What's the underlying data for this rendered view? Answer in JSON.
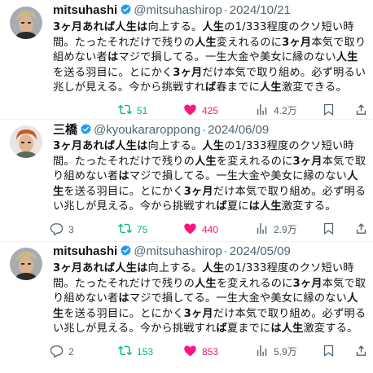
{
  "colors": {
    "retweet": "#00ba7c",
    "like": "#f91880",
    "verified": "#1d9bf0",
    "muted": "#536471"
  },
  "tweets": [
    {
      "name": "mitsuhashi",
      "verified": true,
      "handle": "@mitsuhashirop",
      "date": "2024/10/21",
      "segments": [
        {
          "t": "3ヶ月あれば人生は",
          "b": true
        },
        {
          "t": "向上する。",
          "b": false
        },
        {
          "t": "人生",
          "b": true
        },
        {
          "t": "の1/333程度のクソ短い時間。たったそれだけで残りの",
          "b": false
        },
        {
          "t": "人生",
          "b": true
        },
        {
          "t": "変えれるのに",
          "b": false
        },
        {
          "t": "3ヶ月",
          "b": true
        },
        {
          "t": "本気で取り組めない者",
          "b": false
        },
        {
          "t": "は",
          "b": true
        },
        {
          "t": "マジで損してる。一生大金や美女に縁のない",
          "b": false
        },
        {
          "t": "人生",
          "b": true
        },
        {
          "t": "を送る羽目に。とにかく",
          "b": false
        },
        {
          "t": "3ヶ月",
          "b": true
        },
        {
          "t": "だけ本気で取り組め。必ず明るい兆しが見える。今から挑戦すれ",
          "b": false
        },
        {
          "t": "ば",
          "b": true
        },
        {
          "t": "春までに",
          "b": false
        },
        {
          "t": "人生",
          "b": true
        },
        {
          "t": "激変できる。",
          "b": false
        }
      ],
      "reply_count": "",
      "retweet_count": "51",
      "like_count": "425",
      "view_count": "4.2万"
    },
    {
      "name": "三橋",
      "verified": true,
      "handle": "@kyoukararoppong",
      "date": "2024/06/09",
      "segments": [
        {
          "t": "3ヶ月あれば人生は",
          "b": true
        },
        {
          "t": "向上する。",
          "b": false
        },
        {
          "t": "人生",
          "b": true
        },
        {
          "t": "の1/333程度のクソ短い時間。たったそれだけで残りの",
          "b": false
        },
        {
          "t": "人生",
          "b": true
        },
        {
          "t": "を変えれるのに",
          "b": false
        },
        {
          "t": "3ヶ月",
          "b": true
        },
        {
          "t": "本気で取り組めない者",
          "b": false
        },
        {
          "t": "は",
          "b": true
        },
        {
          "t": "マジで損してる。一生大金や美女に縁のない",
          "b": false
        },
        {
          "t": "人生",
          "b": true
        },
        {
          "t": "を送る羽目に。とにかく",
          "b": false
        },
        {
          "t": "3ヶ月",
          "b": true
        },
        {
          "t": "だけ本気で取り組め。必ず明るい兆しが見える。今から挑戦すれ",
          "b": false
        },
        {
          "t": "ば",
          "b": true
        },
        {
          "t": "夏に",
          "b": false
        },
        {
          "t": "は人生",
          "b": true
        },
        {
          "t": "激変する。",
          "b": false
        }
      ],
      "reply_count": "3",
      "retweet_count": "75",
      "like_count": "440",
      "view_count": "2.9万"
    },
    {
      "name": "mitsuhashi",
      "verified": true,
      "handle": "@mitsuhashirop",
      "date": "2024/05/09",
      "segments": [
        {
          "t": "3ヶ月あれば人生は",
          "b": true
        },
        {
          "t": "向上する。",
          "b": false
        },
        {
          "t": "人生",
          "b": true
        },
        {
          "t": "の1/333程度のクソ短い時間。たったそれだけで残りの",
          "b": false
        },
        {
          "t": "人生",
          "b": true
        },
        {
          "t": "を変えれるのに",
          "b": false
        },
        {
          "t": "3ヶ月",
          "b": true
        },
        {
          "t": "本気で取り組めない者",
          "b": false
        },
        {
          "t": "は",
          "b": true
        },
        {
          "t": "マジで損してる。一生大金や美女に縁のない",
          "b": false
        },
        {
          "t": "人生",
          "b": true
        },
        {
          "t": "を送る羽目に。とにかく",
          "b": false
        },
        {
          "t": "3ヶ月",
          "b": true
        },
        {
          "t": "だけ本気で取り組め。必ず明るい兆しが見える。今から挑戦すれ",
          "b": false
        },
        {
          "t": "ば",
          "b": true
        },
        {
          "t": "夏までに",
          "b": false
        },
        {
          "t": "は人生",
          "b": true
        },
        {
          "t": "激変する。",
          "b": false
        }
      ],
      "reply_count": "2",
      "retweet_count": "153",
      "like_count": "853",
      "view_count": "5.9万"
    }
  ]
}
